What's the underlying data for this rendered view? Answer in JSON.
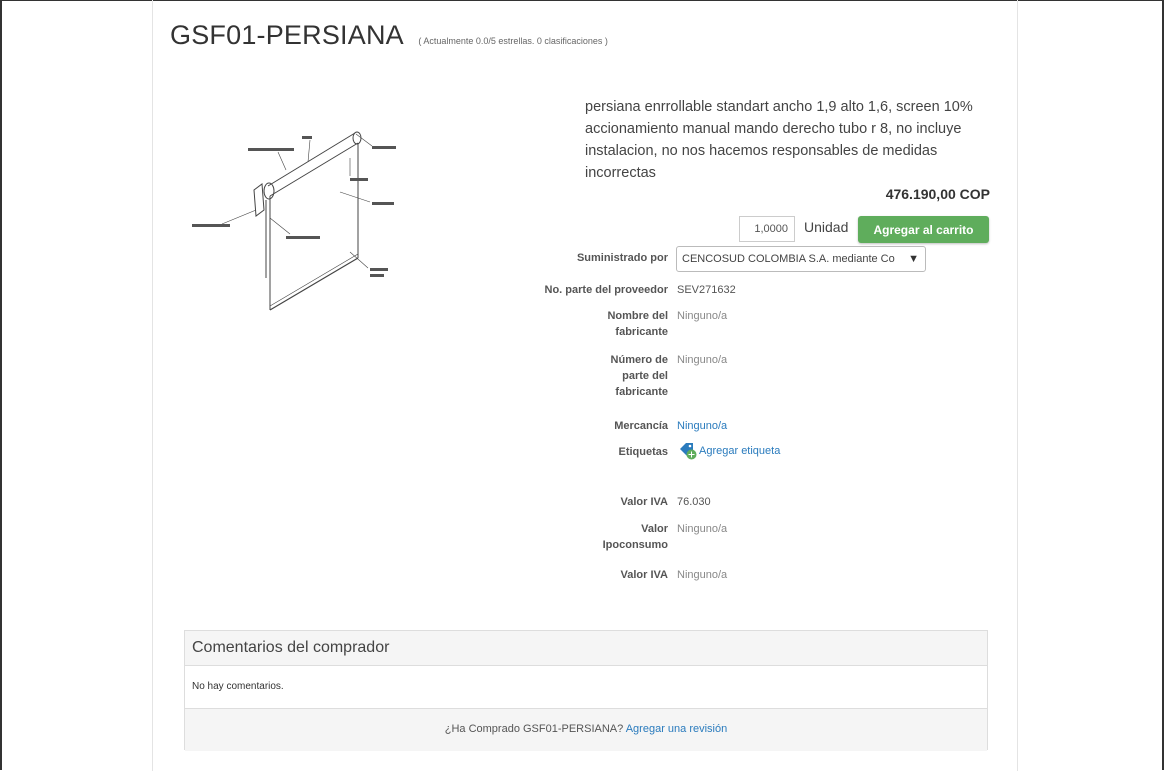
{
  "product": {
    "title": "GSF01-PERSIANA",
    "rating_text": "( Actualmente 0.0/5 estrellas. 0 clasificaciones )",
    "description": "persiana enrrollable standart ancho 1,9 alto 1,6, screen 10% accionamiento manual mando derecho tubo r 8, no incluye instalacion, no nos hacemos responsables de medidas incorrectas",
    "price": "476.190,00 COP",
    "quantity": "1,0000",
    "unit": "Unidad",
    "add_to_cart_label": "Agregar al carrito"
  },
  "attributes": {
    "supplier_label": "Suministrado por",
    "supplier_value": "CENCOSUD COLOMBIA S.A. mediante Co",
    "supplier_part_label": "No. parte del proveedor",
    "supplier_part_value": "SEV271632",
    "manufacturer_name_label_1": "Nombre del",
    "manufacturer_name_label_2": "fabricante",
    "manufacturer_name_value": "Ninguno/a",
    "manufacturer_part_label_1": "Número de",
    "manufacturer_part_label_2": "parte del",
    "manufacturer_part_label_3": "fabricante",
    "manufacturer_part_value": "Ninguno/a",
    "commodity_label": "Mercancía",
    "commodity_value": "Ninguno/a",
    "tags_label": "Etiquetas",
    "add_tag_label": "Agregar etiqueta",
    "iva_label": "Valor IVA",
    "iva_value": "76.030",
    "ipoconsumo_label_1": "Valor",
    "ipoconsumo_label_2": "Ipoconsumo",
    "ipoconsumo_value": "Ninguno/a",
    "iva2_label": "Valor IVA",
    "iva2_value": "Ninguno/a"
  },
  "comments": {
    "header": "Comentarios del comprador",
    "empty_text": "No hay comentarios.",
    "footer_question": "¿Ha Comprado GSF01-PERSIANA?",
    "footer_link": "Agregar una revisión"
  },
  "colors": {
    "add_button": "#5fad5c",
    "link": "#2a7bbd"
  },
  "icons": {
    "tag": "tag-plus-icon",
    "select_chevron": "chevron-down-icon"
  }
}
